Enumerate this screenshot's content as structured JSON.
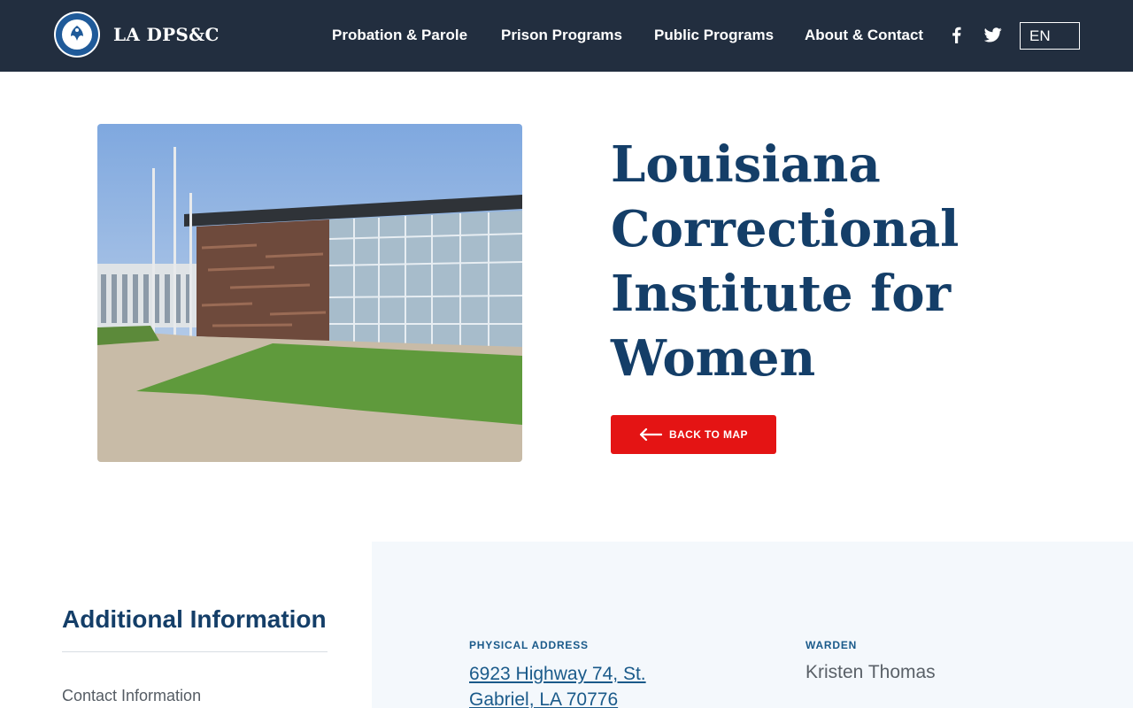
{
  "header": {
    "brand": "LA DPS&C",
    "nav": [
      "Probation & Parole",
      "Prison Programs",
      "Public Programs",
      "About & Contact"
    ],
    "social_icons": [
      "facebook-icon",
      "twitter-icon"
    ],
    "language": "EN"
  },
  "hero": {
    "title": "Louisiana Correctional Institute for Women",
    "back_button": "BACK TO MAP",
    "photo_icon": "facility-building-photo"
  },
  "info": {
    "heading": "Additional Information",
    "links": [
      "Contact Information"
    ],
    "physical_address_label": "PHYSICAL ADDRESS",
    "physical_address": "6923 Highway 74, St. Gabriel, LA 70776",
    "warden_label": "WARDEN",
    "warden": "Kristen Thomas"
  },
  "colors": {
    "header_bg": "#222e3f",
    "title": "#143e68",
    "accent_red": "#e41414",
    "link": "#1a5a8a",
    "panel_bg": "#f4f8fc"
  }
}
